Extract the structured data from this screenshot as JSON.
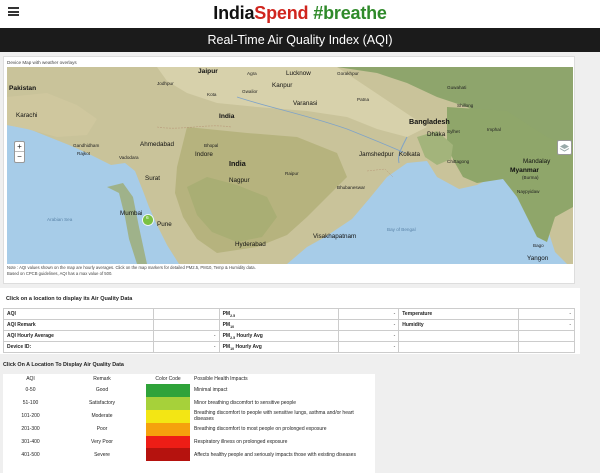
{
  "brand": {
    "part1": "India",
    "part2": "Spend",
    "part3": "#breathe"
  },
  "title": "Real-Time Air Quality Index (AQI)",
  "map": {
    "caption": "Device Map with weather overlays",
    "zoom_in": "+",
    "zoom_out": "−",
    "labels": {
      "jaipur": "Jaipur",
      "lucknow": "Lucknow",
      "kanpur": "Kanpur",
      "pakistan": "Pakistan",
      "karachi": "Karachi",
      "varanasi": "Varanasi",
      "ahmedabad": "Ahmedabad",
      "bhopal": "Bhopal",
      "india": "India",
      "indore": "Indore",
      "jamshedpur": "Jamshedpur",
      "bangladesh": "Bangladesh",
      "dhaka": "Dhaka",
      "kolkata": "Kolkata",
      "surat": "Surat",
      "nagpur": "Nagpur",
      "myanmar": "Myanmar",
      "burma": "(Burma)",
      "mandalay": "Mandalay",
      "mumbai": "Mumbai",
      "pune": "Pune",
      "hyderabad": "Hyderabad",
      "visakhapatnam": "Visakhapatnam",
      "bay": "Bay of Bengal",
      "arabian": "Arabian Sea",
      "yangon": "Yangon",
      "chittagong": "Chittagong",
      "sylhet": "Sylhet",
      "bhubaneswar": "Bhubaneswar",
      "gandhidham": "Gandhidham",
      "gorakhpur": "Gorakhpur",
      "naypyidaw": "Naypyidaw",
      "raipur": "Raipur",
      "bago": "Bago",
      "rajkot": "Rajkot",
      "vadodara": "Vadodara",
      "patna": "Patna",
      "imphal": "Imphal",
      "guwahati": "Guwahati",
      "shillong": "Shillong",
      "jodhpur": "Jodhpur",
      "kota": "Kota",
      "gwalior": "Gwalior",
      "agra": "Agra"
    },
    "marker_count": "6",
    "note_line1": "Note : AQI values shown on the map are hourly averages. Click on the map markers for detailed PM2.5, PM10, Temp & Humidity data.",
    "note_line2": "Based on CPCB guidelines, AQI has a max value of 500."
  },
  "data_panel": {
    "heading": "Click on a location to display its Air Quality Data",
    "rows": [
      {
        "l1": "AQI",
        "v1": "",
        "l2": "PM",
        "l2sub": "2.5",
        "l2tail": "",
        "v2": "-",
        "l3": "Temperature",
        "v3": "-"
      },
      {
        "l1": "AQI Remark",
        "v1": "",
        "l2": "PM",
        "l2sub": "10",
        "l2tail": "",
        "v2": "-",
        "l3": "Humidity",
        "v3": "-"
      },
      {
        "l1": "AQI Hourly Average",
        "v1": "-",
        "l2": "PM",
        "l2sub": "2.5",
        "l2tail": " Hourly Avg",
        "v2": "-",
        "l3": "",
        "v3": ""
      },
      {
        "l1": "Device ID:",
        "v1": "-",
        "l2": "PM",
        "l2sub": "10",
        "l2tail": " Hourly Avg",
        "v2": "-",
        "l3": "",
        "v3": ""
      }
    ]
  },
  "legend": {
    "heading": "Click On A Location To Display Air Quality Data",
    "headers": [
      "AQI",
      "Remark",
      "Color Code",
      "Possible Health Impacts"
    ],
    "rows": [
      {
        "aqi": "0-50",
        "remark": "Good",
        "color": "#2fa33a",
        "impact": "Minimal impact"
      },
      {
        "aqi": "51-100",
        "remark": "Satisfactory",
        "color": "#a6d13a",
        "impact": "Minor breathing discomfort to sensitive people"
      },
      {
        "aqi": "101-200",
        "remark": "Moderate",
        "color": "#f3e614",
        "impact": "Breathing discomfort to people with sensitive lungs, asthma and/or heart diseases"
      },
      {
        "aqi": "201-300",
        "remark": "Poor",
        "color": "#f5a10d",
        "impact": "Breathing discomfort to most people on prolonged exposure"
      },
      {
        "aqi": "301-400",
        "remark": "Very Poor",
        "color": "#ee1d16",
        "impact": "Respiratory illness on prolonged exposure"
      },
      {
        "aqi": "401-500",
        "remark": "Severe",
        "color": "#b5120e",
        "impact": "Affects healthy people and seriously impacts those with existing diseases"
      }
    ]
  }
}
